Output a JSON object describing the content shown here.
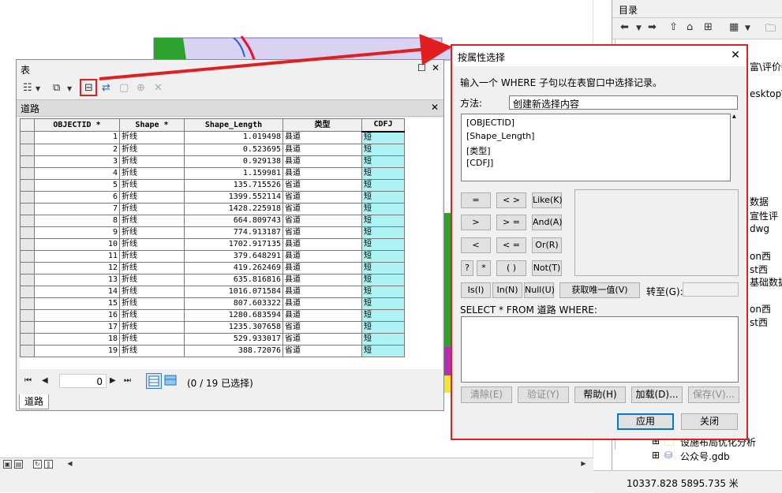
{
  "catalog": {
    "title": "目录",
    "fragments": [
      "富\\评价新",
      "esktop\\",
      "数据",
      "宣性评",
      "dwg",
      "on西",
      "st西",
      "基础数据",
      "on西",
      "st西",
      "设施布局优化分析",
      "公众号.gdb"
    ]
  },
  "coordinates": "10337.828  5895.735 米",
  "table_window": {
    "title": "表",
    "tab_title": "道路",
    "bottom_tab": "道路",
    "columns": [
      "OBJECTID *",
      "Shape *",
      "Shape_Length",
      "类型",
      "CDFJ"
    ],
    "rows": [
      [
        "1",
        "折线",
        "1.019498",
        "县道",
        "短"
      ],
      [
        "2",
        "折线",
        "0.523695",
        "县道",
        "短"
      ],
      [
        "3",
        "折线",
        "0.929138",
        "县道",
        "短"
      ],
      [
        "4",
        "折线",
        "1.159981",
        "县道",
        "短"
      ],
      [
        "5",
        "折线",
        "135.715526",
        "省道",
        "短"
      ],
      [
        "6",
        "折线",
        "1399.552114",
        "省道",
        "短"
      ],
      [
        "7",
        "折线",
        "1428.225918",
        "省道",
        "短"
      ],
      [
        "8",
        "折线",
        "664.809743",
        "省道",
        "短"
      ],
      [
        "9",
        "折线",
        "774.913187",
        "省道",
        "短"
      ],
      [
        "10",
        "折线",
        "1702.917135",
        "县道",
        "短"
      ],
      [
        "11",
        "折线",
        "379.648291",
        "县道",
        "短"
      ],
      [
        "12",
        "折线",
        "419.262469",
        "县道",
        "短"
      ],
      [
        "13",
        "折线",
        "635.816816",
        "县道",
        "短"
      ],
      [
        "14",
        "折线",
        "1016.071584",
        "县道",
        "短"
      ],
      [
        "15",
        "折线",
        "807.603322",
        "县道",
        "短"
      ],
      [
        "16",
        "折线",
        "1280.683594",
        "县道",
        "短"
      ],
      [
        "17",
        "折线",
        "1235.307658",
        "省道",
        "短"
      ],
      [
        "18",
        "折线",
        "529.933017",
        "省道",
        "短"
      ],
      [
        "19",
        "折线",
        "388.72076",
        "省道",
        "短"
      ]
    ],
    "nav": {
      "current": "0",
      "selection": "(0 / 19 已选择)"
    }
  },
  "dialog": {
    "title": "按属性选择",
    "description": "输入一个 WHERE 子句以在表窗口中选择记录。",
    "method_label": "方法:",
    "method_value": "创建新选择内容",
    "fields": [
      "[OBJECTID]",
      "[Shape_Length]",
      "[类型]",
      "[CDFJ]"
    ],
    "operators": {
      "eq": "=",
      "ne": "< >",
      "like": "Like(K)",
      "gt": ">",
      "ge": "> =",
      "and": "And(A)",
      "lt": "<",
      "le": "< =",
      "or": "Or(R)",
      "q": "?",
      "star": "*",
      "paren": "( )",
      "not": "Not(T)",
      "is": "Is(I)",
      "in": "In(N)",
      "null": "Null(U)",
      "unique": "获取唯一值(V)"
    },
    "goto_label": "转至(G):",
    "select_from": "SELECT * FROM 道路 WHERE:",
    "where_clause": "",
    "buttons": {
      "clear": "清除(E)",
      "verify": "验证(Y)",
      "help": "帮助(H)",
      "load": "加载(D)...",
      "save": "保存(V)...",
      "apply": "应用",
      "close": "关闭"
    }
  },
  "colors": {
    "highlight_red": "#e02020",
    "cdfj_cyan": "#aef3f3",
    "map_purple": "#d9d2f2",
    "map_green": "#2ea22e",
    "road_red": "#e8102a",
    "road_blue": "#1f5fe0"
  }
}
